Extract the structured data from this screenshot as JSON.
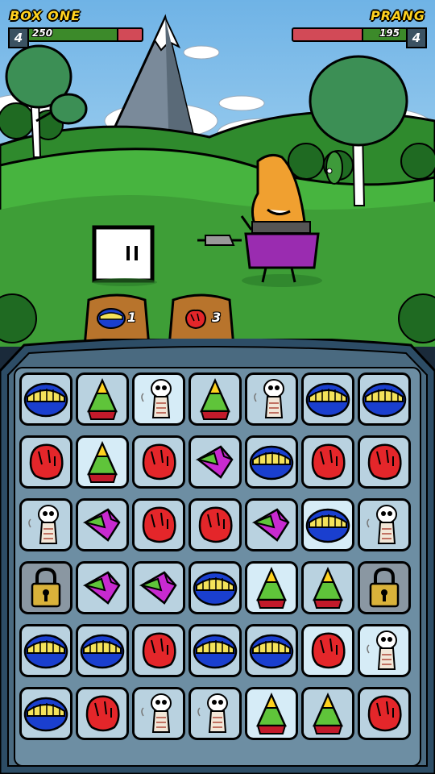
{
  "player": {
    "name": "BOX ONE",
    "level": "4",
    "hp": "250",
    "hp_fraction": 0.78
  },
  "enemy": {
    "name": "PRANG",
    "level": "4",
    "hp": "195",
    "hp_fraction": 0.38
  },
  "abilities": [
    {
      "icon": "blue-mouth-icon",
      "count": "1"
    },
    {
      "icon": "red-fist-icon",
      "count": "3"
    }
  ],
  "board": {
    "rows": [
      [
        "mouth",
        "cone",
        "skeleton",
        "cone",
        "skeleton",
        "mouth",
        "mouth"
      ],
      [
        "fist",
        "cone",
        "fist",
        "bird",
        "mouth",
        "fist",
        "fist"
      ],
      [
        "skeleton",
        "bird",
        "fist",
        "fist",
        "bird",
        "mouth",
        "skeleton"
      ],
      [
        "lock",
        "bird",
        "bird",
        "mouth",
        "cone",
        "cone",
        "lock"
      ],
      [
        "mouth",
        "mouth",
        "fist",
        "mouth",
        "mouth",
        "fist",
        "skeleton"
      ],
      [
        "mouth",
        "fist",
        "skeleton",
        "skeleton",
        "cone",
        "cone",
        "fist"
      ]
    ],
    "light_tiles": [
      [
        0,
        0,
        1,
        0,
        0,
        0,
        0
      ],
      [
        0,
        1,
        0,
        0,
        0,
        0,
        0
      ],
      [
        0,
        0,
        0,
        0,
        0,
        1,
        0
      ],
      [
        0,
        0,
        0,
        0,
        1,
        0,
        0
      ],
      [
        0,
        0,
        0,
        0,
        0,
        1,
        1
      ],
      [
        0,
        0,
        0,
        0,
        1,
        0,
        0
      ]
    ]
  },
  "colors": {
    "sky": "#a9d8f5",
    "grass": "#3fa83a",
    "board": "#4a6a80",
    "tile": "#b9d2e0",
    "tile_light": "#d6ecf7"
  }
}
